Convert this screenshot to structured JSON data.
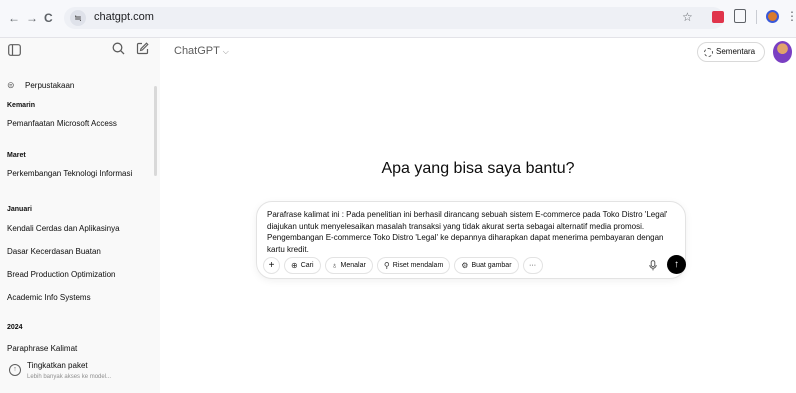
{
  "browser": {
    "back": "←",
    "forward": "→",
    "reload": "C",
    "site_icon": "≒",
    "url": "chatgpt.com",
    "bookmark": "☆",
    "menu": "⋮"
  },
  "sidebar": {
    "library_label": "Perpustakaan",
    "groups": [
      {
        "heading": "Kemarin",
        "items": [
          "Pemanfaatan Microsoft Access"
        ]
      },
      {
        "heading": "Maret",
        "items": [
          "Perkembangan Teknologi Informasi"
        ]
      },
      {
        "heading": "Januari",
        "items": [
          "Kendali Cerdas dan Aplikasinya",
          "Dasar Kecerdasan Buatan",
          "Bread Production Optimization",
          "Academic Info Systems"
        ]
      },
      {
        "heading": "2024",
        "items": [
          "Paraphrase Kalimat"
        ]
      }
    ],
    "upgrade": {
      "title": "Tingkatkan paket",
      "subtitle": "Lebih banyak akses ke model..."
    }
  },
  "main": {
    "model_label": "ChatGPT",
    "temporary_label": "Sementara",
    "headline": "Apa yang bisa saya bantu?",
    "prompt_text": "Parafrase kalimat ini : Pada penelitian ini berhasil dirancang sebuah sistem E-commerce pada Toko Distro 'Legal' diajukan untuk menyelesaikan masalah transaksi yang tidak akurat serta sebagai alternatif media promosi. Pengembangan E-commerce Toko Distro 'Legal' ke depannya diharapkan dapat menerima pembayaran dengan kartu kredit.",
    "tools": {
      "add": "+",
      "search": "Cari",
      "reason": "Menalar",
      "deep_research": "Riset mendalam",
      "create_image": "Buat gambar",
      "more": "···"
    }
  },
  "colors": {
    "sidebar_bg": "#f9f9f9",
    "send_button": "#000000",
    "browser_bar": "#f7f8fb"
  }
}
